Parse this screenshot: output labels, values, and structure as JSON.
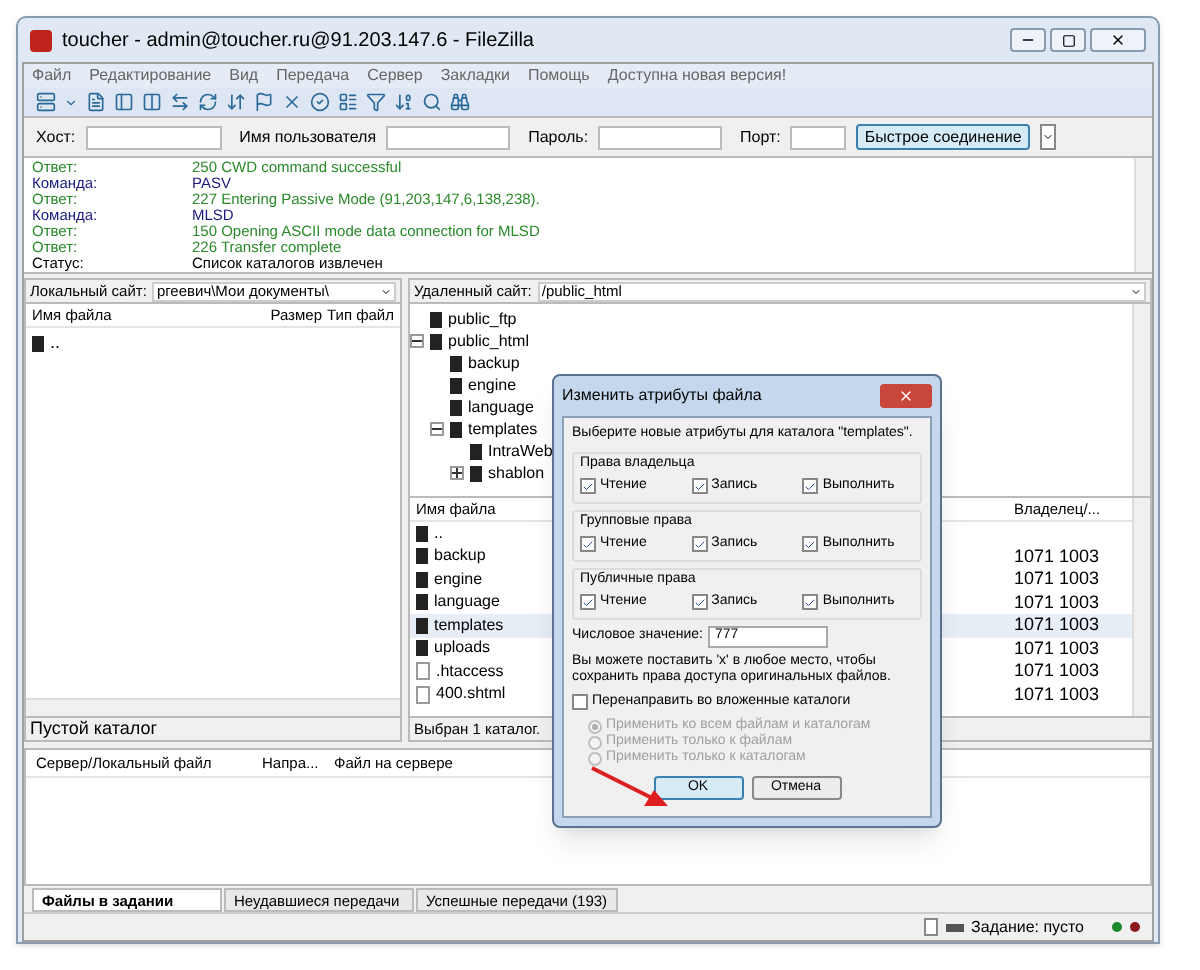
{
  "window": {
    "title": "toucher - admin@toucher.ru@91.203.147.6 - FileZilla"
  },
  "menu": [
    "Файл",
    "Редактирование",
    "Вид",
    "Передача",
    "Сервер",
    "Закладки",
    "Помощь",
    "Доступна новая версия!"
  ],
  "quickconnect": {
    "host_label": "Хост:",
    "user_label": "Имя пользователя",
    "password_label": "Пароль:",
    "port_label": "Порт:",
    "connect_button": "Быстрое соединение"
  },
  "log": [
    {
      "label": "Ответ:",
      "message": "250 CWD command successful",
      "kind": "response"
    },
    {
      "label": "Команда:",
      "message": "PASV",
      "kind": "command"
    },
    {
      "label": "Ответ:",
      "message": "227 Entering Passive Mode (91,203,147,6,138,238).",
      "kind": "response"
    },
    {
      "label": "Команда:",
      "message": "MLSD",
      "kind": "command"
    },
    {
      "label": "Ответ:",
      "message": "150 Opening ASCII mode data connection for MLSD",
      "kind": "response"
    },
    {
      "label": "Ответ:",
      "message": "226 Transfer complete",
      "kind": "response"
    },
    {
      "label": "Статус:",
      "message": "Список каталогов извлечен",
      "kind": "status"
    }
  ],
  "local": {
    "site_label": "Локальный сайт:",
    "path": "ргеевич\\Мои документы\\",
    "columns": [
      "Имя файла",
      "Размер",
      "Тип файл"
    ],
    "files": [
      ".."
    ],
    "status": "Пустой каталог"
  },
  "remote": {
    "site_label": "Удаленный сайт:",
    "path": "/public_html",
    "tree": [
      {
        "name": "public_ftp"
      },
      {
        "name": "public_html",
        "expanded": true,
        "children": [
          {
            "name": "backup"
          },
          {
            "name": "engine"
          },
          {
            "name": "language"
          },
          {
            "name": "templates",
            "expanded": true,
            "children": [
              {
                "name": "IntraWeb"
              },
              {
                "name": "shablon",
                "expanded": false
              }
            ]
          }
        ]
      }
    ],
    "columns": [
      "Имя файла",
      "Владелец/..."
    ],
    "files": [
      {
        "name": "..",
        "kind": "folder",
        "selected": false
      },
      {
        "name": "backup",
        "kind": "folder",
        "owner": "1071 1003",
        "selected": false
      },
      {
        "name": "engine",
        "kind": "folder",
        "owner": "1071 1003",
        "selected": false
      },
      {
        "name": "language",
        "kind": "folder",
        "owner": "1071 1003",
        "selected": false
      },
      {
        "name": "templates",
        "kind": "folder",
        "owner": "1071 1003",
        "selected": true
      },
      {
        "name": "uploads",
        "kind": "folder",
        "owner": "1071 1003",
        "selected": false
      },
      {
        "name": ".htaccess",
        "kind": "file",
        "owner": "1071 1003",
        "selected": false
      },
      {
        "name": "400.shtml",
        "kind": "file",
        "owner": "1071 1003",
        "selected": false
      }
    ],
    "status": "Выбран 1 каталог."
  },
  "queue": {
    "columns": [
      "Сервер/Локальный файл",
      "Напра...",
      "Файл на сервере"
    ],
    "tabs": [
      {
        "label": "Файлы в задании",
        "selected": true
      },
      {
        "label": "Неудавшиеся передачи",
        "selected": false
      },
      {
        "label": "Успешные передачи (193)",
        "selected": false
      }
    ]
  },
  "status_bar": {
    "queue": "Задание: пусто"
  },
  "dialog": {
    "title": "Изменить атрибуты файла",
    "prompt": "Выберите новые атрибуты для каталога \"templates\".",
    "groups": [
      {
        "title": "Права владельца",
        "perms": [
          {
            "label": "Чтение",
            "checked": true
          },
          {
            "label": "Запись",
            "checked": true
          },
          {
            "label": "Выполнить",
            "checked": true
          }
        ]
      },
      {
        "title": "Групповые права",
        "perms": [
          {
            "label": "Чтение",
            "checked": true
          },
          {
            "label": "Запись",
            "checked": true
          },
          {
            "label": "Выполнить",
            "checked": true
          }
        ]
      },
      {
        "title": "Публичные права",
        "perms": [
          {
            "label": "Чтение",
            "checked": true
          },
          {
            "label": "Запись",
            "checked": true
          },
          {
            "label": "Выполнить",
            "checked": true
          }
        ]
      }
    ],
    "numeric_label": "Числовое значение:",
    "numeric_value": "777",
    "hint": "Вы можете поставить 'x' в любое место, чтобы сохранить права доступа оригинальных файлов.",
    "recurse": {
      "label": "Перенаправить во вложенные каталоги",
      "checked": false
    },
    "options": [
      {
        "label": "Применить ко всем файлам и каталогам",
        "selected": true,
        "disabled": true
      },
      {
        "label": "Применить только к файлам",
        "selected": false,
        "disabled": true
      },
      {
        "label": "Применить только к каталогам",
        "selected": false,
        "disabled": true
      }
    ],
    "buttons": [
      {
        "label": "OK",
        "default": true
      },
      {
        "label": "Отмена",
        "default": false
      }
    ]
  }
}
